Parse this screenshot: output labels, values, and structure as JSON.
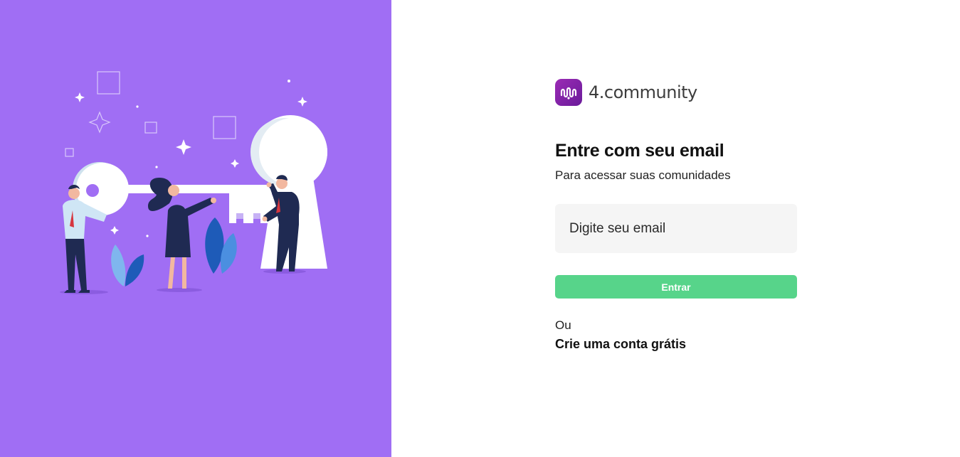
{
  "brand": {
    "name": "4.community",
    "logo_icon": "community-logo-icon",
    "logo_color": "#8a24ad"
  },
  "colors": {
    "left_panel": "#a06ef4",
    "button": "#57d48a",
    "input_bg": "#f5f5f5"
  },
  "login": {
    "title": "Entre com seu email",
    "subtitle": "Para acessar suas comunidades",
    "email_placeholder": "Digite seu email",
    "email_value": "",
    "submit_label": "Entrar",
    "or_label": "Ou",
    "signup_label": "Crie uma conta grátis"
  },
  "illustration": {
    "icon": "people-holding-key-illustration"
  }
}
